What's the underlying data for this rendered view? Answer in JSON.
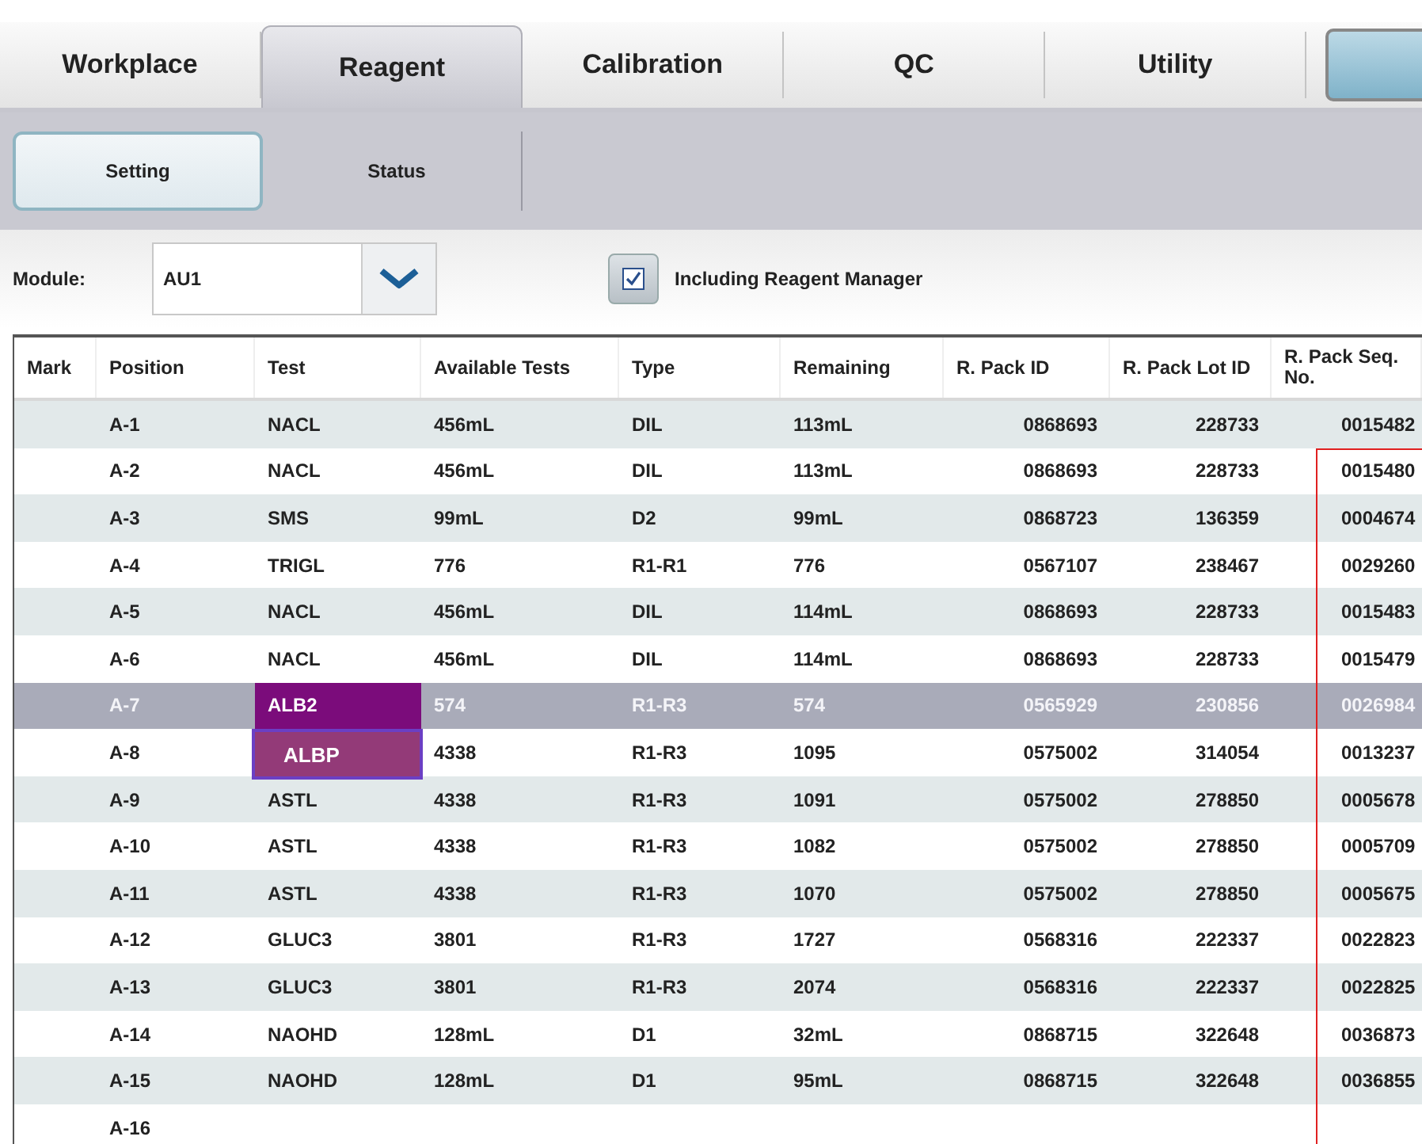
{
  "tabs": [
    {
      "label": "Workplace",
      "selected": false
    },
    {
      "label": "Reagent",
      "selected": true
    },
    {
      "label": "Calibration",
      "selected": false
    },
    {
      "label": "QC",
      "selected": false
    },
    {
      "label": "Utility",
      "selected": false
    }
  ],
  "subtabs": [
    {
      "label": "Setting",
      "selected": true
    },
    {
      "label": "Status",
      "selected": false
    }
  ],
  "module": {
    "label": "Module:",
    "value": "AU1"
  },
  "including_reagent_manager": {
    "label": "Including Reagent Manager",
    "checked": true
  },
  "table": {
    "columns": [
      "Mark",
      "Position",
      "Test",
      "Available Tests",
      "Type",
      "Remaining",
      "R. Pack ID",
      "R. Pack Lot ID",
      "R. Pack Seq. No."
    ],
    "rows": [
      {
        "cells": [
          "",
          "A-1",
          "NACL",
          "456mL",
          "DIL",
          "113mL",
          "0868693",
          "228733",
          "0015482"
        ],
        "selected": false
      },
      {
        "cells": [
          "",
          "A-2",
          "NACL",
          "456mL",
          "DIL",
          "113mL",
          "0868693",
          "228733",
          "0015480"
        ],
        "selected": false
      },
      {
        "cells": [
          "",
          "A-3",
          "SMS",
          "99mL",
          "D2",
          "99mL",
          "0868723",
          "136359",
          "0004674"
        ],
        "selected": false
      },
      {
        "cells": [
          "",
          "A-4",
          "TRIGL",
          "776",
          "R1-R1",
          "776",
          "0567107",
          "238467",
          "0029260"
        ],
        "selected": false
      },
      {
        "cells": [
          "",
          "A-5",
          "NACL",
          "456mL",
          "DIL",
          "114mL",
          "0868693",
          "228733",
          "0015483"
        ],
        "selected": false
      },
      {
        "cells": [
          "",
          "A-6",
          "NACL",
          "456mL",
          "DIL",
          "114mL",
          "0868693",
          "228733",
          "0015479"
        ],
        "selected": false
      },
      {
        "cells": [
          "",
          "A-7",
          "ALB2",
          "574",
          "R1-R3",
          "574",
          "0565929",
          "230856",
          "0026984"
        ],
        "selected": true,
        "test_popup": [
          "ALBP"
        ]
      },
      {
        "cells": [
          "",
          "A-8",
          null,
          "4338",
          "R1-R3",
          "1095",
          "0575002",
          "314054",
          "0013237"
        ],
        "selected": false
      },
      {
        "cells": [
          "",
          "A-9",
          "ASTL",
          "4338",
          "R1-R3",
          "1091",
          "0575002",
          "278850",
          "0005678"
        ],
        "selected": false
      },
      {
        "cells": [
          "",
          "A-10",
          "ASTL",
          "4338",
          "R1-R3",
          "1082",
          "0575002",
          "278850",
          "0005709"
        ],
        "selected": false
      },
      {
        "cells": [
          "",
          "A-11",
          "ASTL",
          "4338",
          "R1-R3",
          "1070",
          "0575002",
          "278850",
          "0005675"
        ],
        "selected": false
      },
      {
        "cells": [
          "",
          "A-12",
          "GLUC3",
          "3801",
          "R1-R3",
          "1727",
          "0568316",
          "222337",
          "0022823"
        ],
        "selected": false
      },
      {
        "cells": [
          "",
          "A-13",
          "GLUC3",
          "3801",
          "R1-R3",
          "2074",
          "0568316",
          "222337",
          "0022825"
        ],
        "selected": false
      },
      {
        "cells": [
          "",
          "A-14",
          "NAOHD",
          "128mL",
          "D1",
          "32mL",
          "0868715",
          "322648",
          "0036873"
        ],
        "selected": false
      },
      {
        "cells": [
          "",
          "A-15",
          "NAOHD",
          "128mL",
          "D1",
          "95mL",
          "0868715",
          "322648",
          "0036855"
        ],
        "selected": false
      },
      {
        "cells": [
          "",
          "A-16"
        ],
        "selected": false
      }
    ]
  }
}
